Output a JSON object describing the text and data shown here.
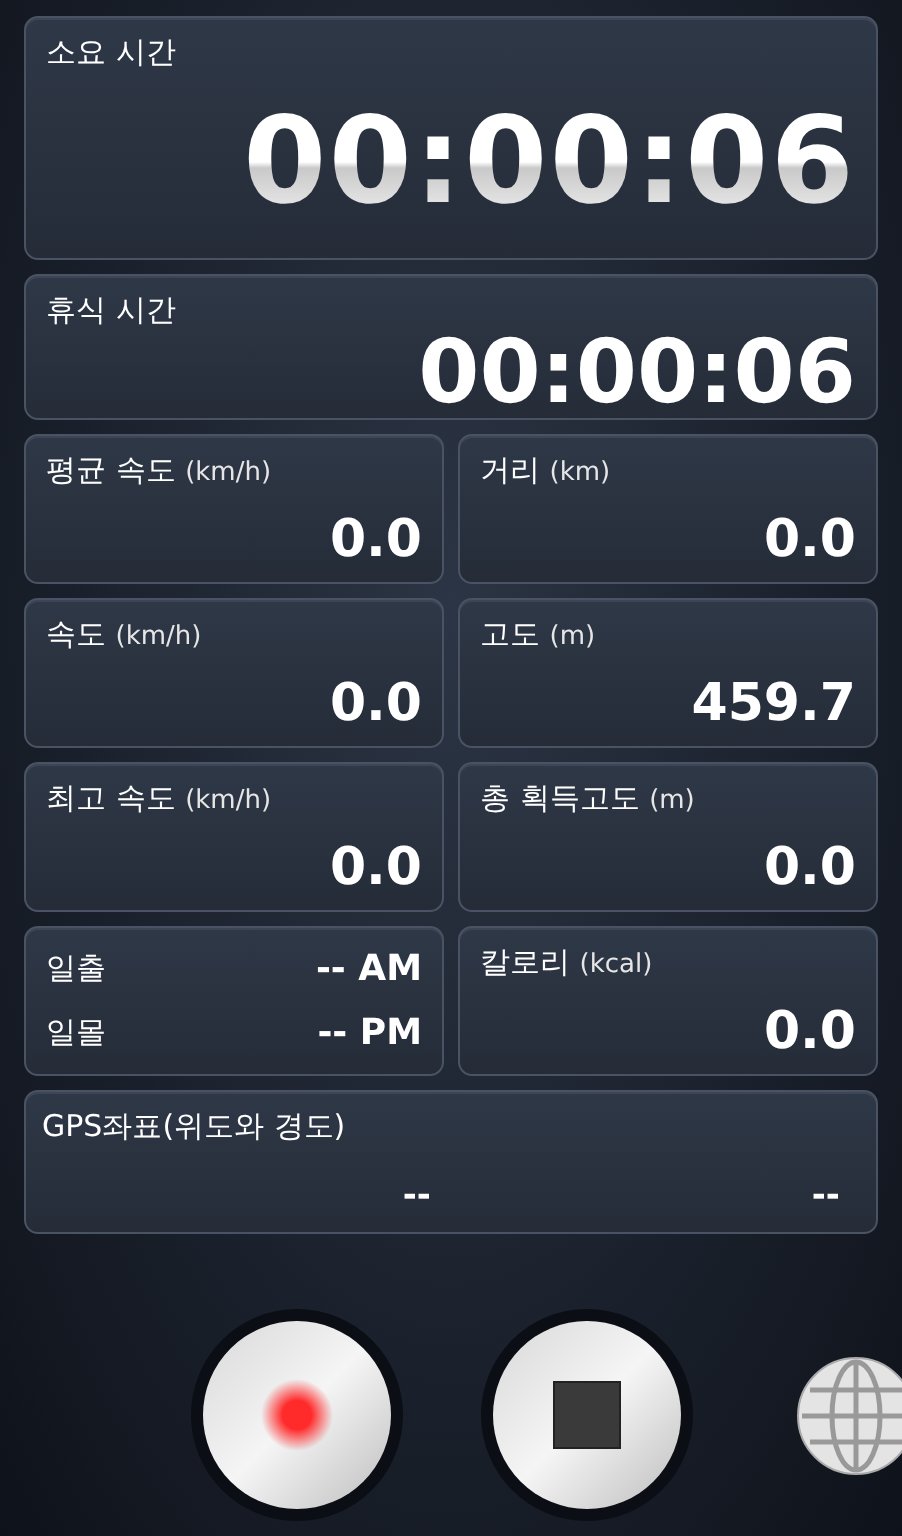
{
  "elapsed": {
    "label": "소요 시간",
    "value": "00:00:06"
  },
  "rest": {
    "label": "휴식 시간",
    "value": "00:00:06"
  },
  "stats": [
    {
      "label": "평균 속도",
      "unit": "(km/h)",
      "value": "0.0"
    },
    {
      "label": "거리",
      "unit": "(km)",
      "value": "0.0"
    },
    {
      "label": "속도",
      "unit": "(km/h)",
      "value": "0.0"
    },
    {
      "label": "고도",
      "unit": "(m)",
      "value": "459.7"
    },
    {
      "label": "최고 속도",
      "unit": "(km/h)",
      "value": "0.0"
    },
    {
      "label": "총 획득고도",
      "unit": "(m)",
      "value": "0.0"
    }
  ],
  "sun": [
    {
      "label": "일출",
      "value": "-- AM"
    },
    {
      "label": "일몰",
      "value": "-- PM"
    }
  ],
  "calories": {
    "label": "칼로리",
    "unit": "(kcal)",
    "value": "0.0"
  },
  "gps": {
    "label": "GPS좌표(위도와 경도)",
    "latitude": "--",
    "longitude": "--"
  },
  "controls": [
    {
      "kind": "record"
    },
    {
      "kind": "stop"
    },
    {
      "kind": "globe"
    }
  ]
}
